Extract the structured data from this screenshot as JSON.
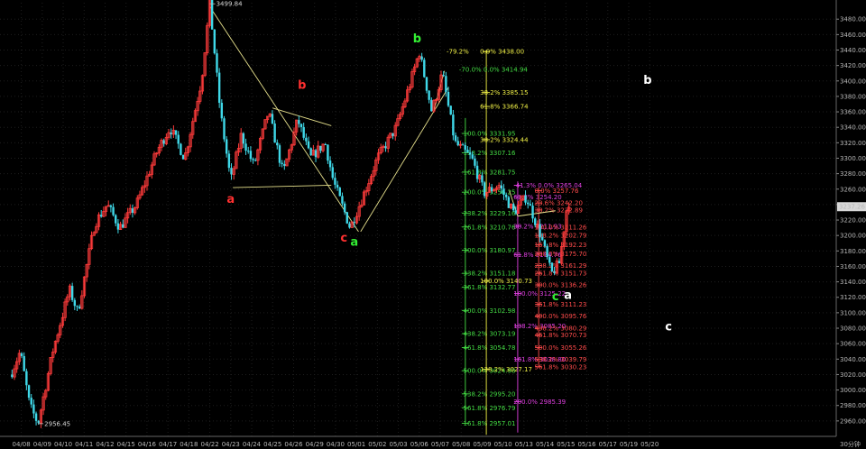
{
  "chart_data": {
    "type": "candlestick",
    "title": "",
    "xlabel": "",
    "ylabel": "",
    "ylim": [
      2940,
      3500
    ],
    "grid": true,
    "colors": {
      "background": "#000000",
      "grid": "#1e1e1e",
      "up": "#ff3b3b",
      "down": "#3fd8e8",
      "axis_text": "#b8b8b8",
      "trend": "#e6e08c",
      "fib_green": "#44dd44",
      "fib_yellow": "#f0f046",
      "fib_magenta": "#e040e0",
      "fib_red": "#ff4b4b"
    },
    "x_labels": [
      "04/08",
      "04/09",
      "04/10",
      "04/11",
      "04/12",
      "04/15",
      "04/16",
      "04/17",
      "04/18",
      "04/22",
      "04/23",
      "04/24",
      "04/25",
      "04/26",
      "04/29",
      "04/30",
      "05/01",
      "05/02",
      "05/03",
      "05/06",
      "05/07",
      "05/08",
      "05/09",
      "05/10",
      "05/13",
      "05/14",
      "05/15",
      "05/16",
      "05/17",
      "05/19",
      "05/20",
      "30分钟"
    ],
    "y_ticks": [
      2960,
      2980,
      3000,
      3020,
      3040,
      3060,
      3080,
      3100,
      3120,
      3140,
      3160,
      3180,
      3200,
      3220,
      3240,
      3260,
      3280,
      3300,
      3320,
      3340,
      3360,
      3380,
      3400,
      3420,
      3440,
      3460,
      3480
    ],
    "last_price": "3237.26",
    "path_points": [
      {
        "d": 0,
        "p": 3020
      },
      {
        "d": 0.45,
        "p": 3050
      },
      {
        "d": 0.9,
        "p": 2980
      },
      {
        "d": 1.3,
        "p": 2956.45
      },
      {
        "d": 2.0,
        "p": 3050
      },
      {
        "d": 2.8,
        "p": 3130
      },
      {
        "d": 3.2,
        "p": 3100
      },
      {
        "d": 4.0,
        "p": 3215
      },
      {
        "d": 4.6,
        "p": 3240
      },
      {
        "d": 5.2,
        "p": 3210
      },
      {
        "d": 6.0,
        "p": 3240
      },
      {
        "d": 7.0,
        "p": 3310
      },
      {
        "d": 7.6,
        "p": 3340
      },
      {
        "d": 8.3,
        "p": 3300
      },
      {
        "d": 9.1,
        "p": 3400
      },
      {
        "d": 9.5,
        "p": 3499.84
      },
      {
        "d": 10.0,
        "p": 3360
      },
      {
        "d": 10.5,
        "p": 3270
      },
      {
        "d": 11.0,
        "p": 3330
      },
      {
        "d": 11.6,
        "p": 3290
      },
      {
        "d": 12.3,
        "p": 3360
      },
      {
        "d": 13.0,
        "p": 3280
      },
      {
        "d": 13.7,
        "p": 3350
      },
      {
        "d": 14.3,
        "p": 3300
      },
      {
        "d": 15.0,
        "p": 3320
      },
      {
        "d": 15.4,
        "p": 3270
      },
      {
        "d": 16.2,
        "p": 3210
      },
      {
        "d": 16.8,
        "p": 3250
      },
      {
        "d": 17.5,
        "p": 3300
      },
      {
        "d": 18.4,
        "p": 3340
      },
      {
        "d": 19.1,
        "p": 3400
      },
      {
        "d": 19.5,
        "p": 3438
      },
      {
        "d": 20.1,
        "p": 3360
      },
      {
        "d": 20.6,
        "p": 3410
      },
      {
        "d": 21.2,
        "p": 3320
      },
      {
        "d": 22.0,
        "p": 3300
      },
      {
        "d": 22.6,
        "p": 3255
      },
      {
        "d": 23.3,
        "p": 3265
      },
      {
        "d": 24.0,
        "p": 3230
      },
      {
        "d": 24.6,
        "p": 3250
      },
      {
        "d": 25.3,
        "p": 3200
      },
      {
        "d": 25.8,
        "p": 3150
      },
      {
        "d": 26.2,
        "p": 3165
      },
      {
        "d": 26.6,
        "p": 3248
      },
      {
        "d": 26.7,
        "p": 3237.26
      }
    ],
    "peak_labels": [
      {
        "text": "3499.84",
        "d": 9.5,
        "p": 3499.84
      },
      {
        "text": "2956.45",
        "d": 1.3,
        "p": 2956.45
      }
    ],
    "wave_labels": [
      {
        "text": "a",
        "color": "#ff3030",
        "d": 10.5,
        "p": 3242
      },
      {
        "text": "b",
        "color": "#ff3030",
        "d": 13.9,
        "p": 3390
      },
      {
        "text": "c",
        "color": "#ff3030",
        "d": 15.9,
        "p": 3192
      },
      {
        "text": "a",
        "color": "#33ee33",
        "d": 16.4,
        "p": 3187
      },
      {
        "text": "b",
        "color": "#33ee33",
        "d": 19.4,
        "p": 3450
      },
      {
        "text": "c",
        "color": "#33ee33",
        "d": 26.0,
        "p": 3116
      },
      {
        "text": "a",
        "color": "#ffffff",
        "d": 26.6,
        "p": 3118
      },
      {
        "text": "b",
        "color": "#ffffff",
        "d": 30.4,
        "p": 3396
      },
      {
        "text": "c",
        "color": "#ffffff",
        "d": 31.4,
        "p": 3077
      }
    ],
    "trend_lines": [
      {
        "d1": 9.5,
        "p1": 3496,
        "d2": 16.6,
        "p2": 3205
      },
      {
        "d1": 10.6,
        "p1": 3262,
        "d2": 15.3,
        "p2": 3265
      },
      {
        "d1": 12.5,
        "p1": 3365,
        "d2": 15.3,
        "p2": 3342
      },
      {
        "d1": 16.7,
        "p1": 3205,
        "d2": 20.9,
        "p2": 3392
      },
      {
        "d1": 20.2,
        "p1": 3362,
        "d2": 20.7,
        "p2": 3413
      },
      {
        "d1": 23.8,
        "p1": 3258,
        "d2": 24.2,
        "p2": 3225
      },
      {
        "d1": 24.2,
        "p1": 3225,
        "d2": 26.0,
        "p2": 3232
      }
    ],
    "fib_sets": [
      {
        "id": "green",
        "color": "#44dd44",
        "vline_d": 21.7,
        "p_top": 3352,
        "p_bot": 2957,
        "label_d": 21.6,
        "levels": [
          {
            "text": "100.0% 3331.95",
            "p": 3332
          },
          {
            "text": "138.2% 3307.16",
            "p": 3307
          },
          {
            "text": "161.8% 3281.75",
            "p": 3282
          },
          {
            "text": "200.0% 3256.25",
            "p": 3256
          },
          {
            "text": "238.2% 3229.16",
            "p": 3229
          },
          {
            "text": "261.8% 3210.76",
            "p": 3211
          },
          {
            "text": "300.0% 3180.97",
            "p": 3181
          },
          {
            "text": "338.2% 3151.18",
            "p": 3151
          },
          {
            "text": "361.8% 3132.77",
            "p": 3133
          },
          {
            "text": "400.0% 3102.98",
            "p": 3103
          },
          {
            "text": "438.2% 3073.19",
            "p": 3073
          },
          {
            "text": "461.8% 3054.78",
            "p": 3055
          },
          {
            "text": "500.0% 3024.98",
            "p": 3025
          },
          {
            "text": "538.2% 2995.20",
            "p": 2995
          },
          {
            "text": "561.8% 2976.79",
            "p": 2977
          },
          {
            "text": "161.8% 2957.01",
            "p": 2957
          }
        ]
      },
      {
        "id": "yellow",
        "color": "#f0f046",
        "vline_d": 22.7,
        "p_top": 3440,
        "p_bot": 2942,
        "label_d": 22.4,
        "levels": [
          {
            "text": "-79.2%",
            "p": 3438,
            "d": 20.8
          },
          {
            "text": "0.0% 3438.00",
            "p": 3438
          },
          {
            "text": "38.2% 3385.15",
            "p": 3385
          },
          {
            "text": "61.8% 3366.74",
            "p": 3367
          },
          {
            "text": "38.2% 3324.44",
            "p": 3324
          },
          {
            "text": "100.0% 3140.73",
            "p": 3141
          },
          {
            "text": "138.2% 3027.17",
            "p": 3027
          }
        ]
      },
      {
        "id": "green2",
        "color": "#44dd44",
        "vline_d": null,
        "p_top": 3414,
        "p_bot": 3414,
        "label_d": 21.4,
        "levels": [
          {
            "text": "-70.0% 0.0% 3414.94",
            "p": 3415
          }
        ]
      },
      {
        "id": "magenta",
        "color": "#e040e0",
        "vline_d": 24.2,
        "p_top": 3270,
        "p_bot": 2945,
        "label_d": 24.0,
        "levels": [
          {
            "text": "-41.3% 0.0% 3265.04",
            "p": 3265
          },
          {
            "text": "61.8% 3254.20",
            "p": 3250
          },
          {
            "text": "38.2% 3211.93",
            "p": 3212
          },
          {
            "text": "61.8% 3194.76",
            "p": 3175
          },
          {
            "text": "100.0% 3125.22",
            "p": 3125
          },
          {
            "text": "138.2% 3085.20",
            "p": 3083
          },
          {
            "text": "161.8% 3038.80",
            "p": 3040
          },
          {
            "text": "200.0% 2985.39",
            "p": 2985
          }
        ]
      },
      {
        "id": "red",
        "color": "#ff4b4b",
        "vline_d": 25.2,
        "p_top": 3262,
        "p_bot": 3030,
        "label_d": 25.0,
        "levels": [
          {
            "text": "0.0% 3257.76",
            "p": 3258
          },
          {
            "text": "23.6% 3242.20",
            "p": 3242
          },
          {
            "text": "38.2% 3232.89",
            "p": 3233
          },
          {
            "text": "100.0% 3211.26",
            "p": 3211
          },
          {
            "text": "138.2% 3202.79",
            "p": 3200
          },
          {
            "text": "161.8% 3192.23",
            "p": 3188
          },
          {
            "text": "200.0% 3175.70",
            "p": 3176
          },
          {
            "text": "238.2% 3161.29",
            "p": 3161
          },
          {
            "text": "261.8% 3151.73",
            "p": 3151
          },
          {
            "text": "300.0% 3136.26",
            "p": 3136
          },
          {
            "text": "361.8% 3111.23",
            "p": 3111
          },
          {
            "text": "400.0% 3095.76",
            "p": 3096
          },
          {
            "text": "438.2% 3080.29",
            "p": 3080
          },
          {
            "text": "461.8% 3070.73",
            "p": 3071
          },
          {
            "text": "500.0% 3055.26",
            "p": 3055
          },
          {
            "text": "538.2% 3039.79",
            "p": 3040
          },
          {
            "text": "561.8% 3030.23",
            "p": 3030
          }
        ]
      }
    ]
  }
}
